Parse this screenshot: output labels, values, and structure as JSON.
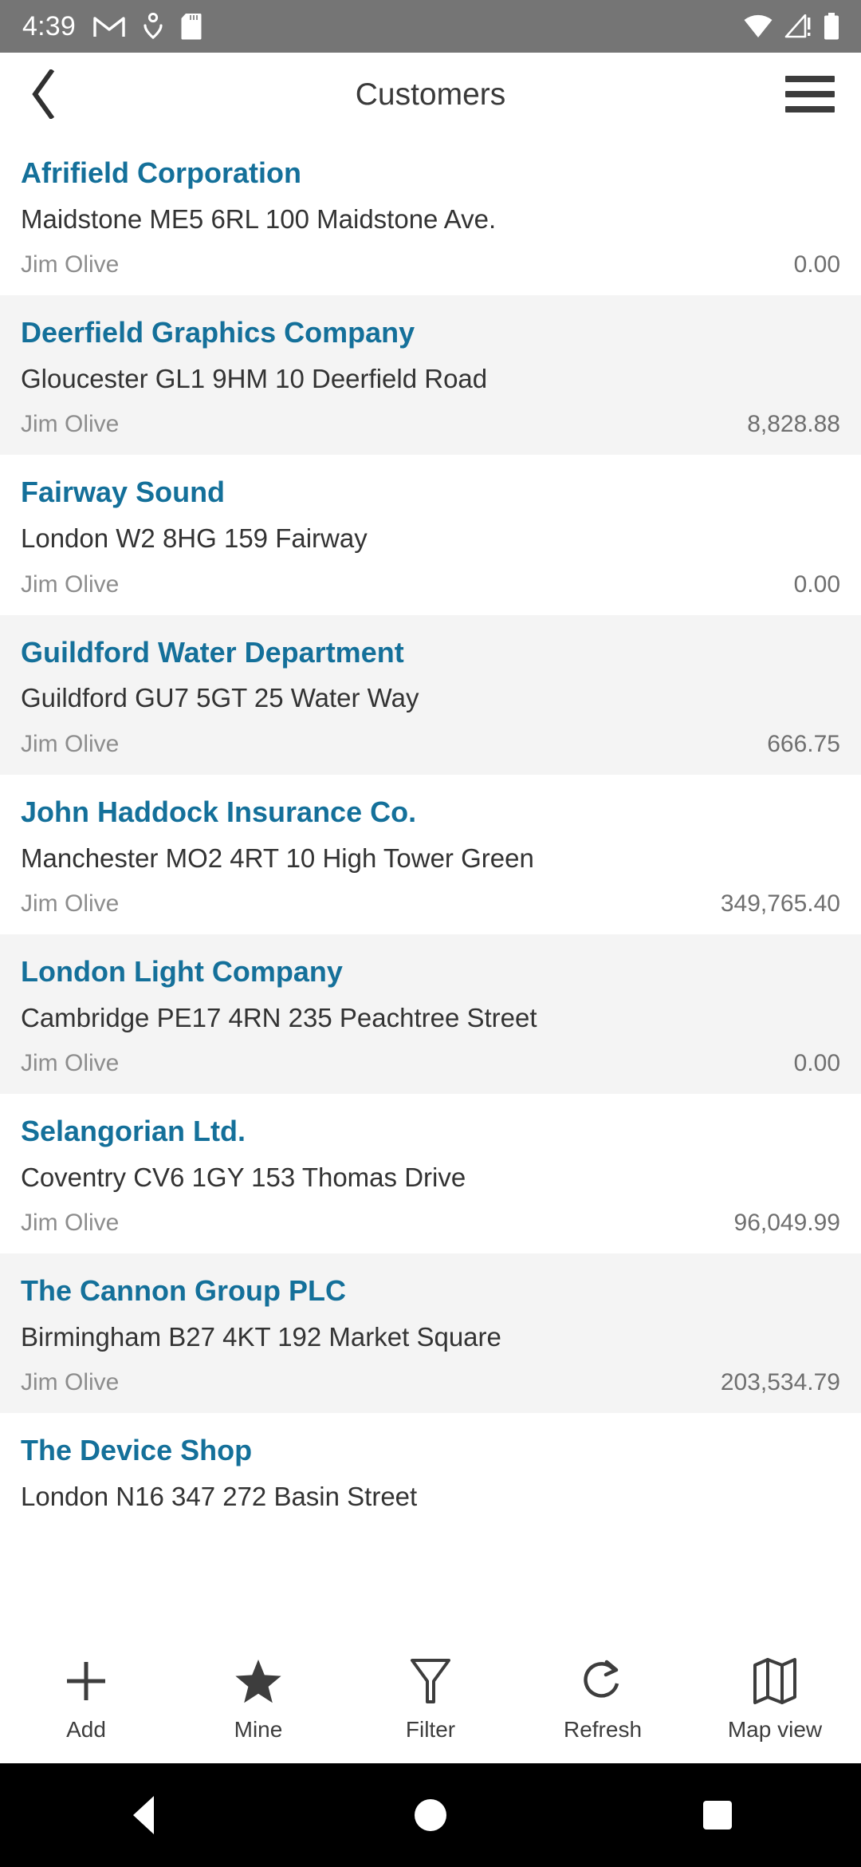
{
  "status_bar": {
    "time": "4:39",
    "left_icons": [
      "gmail-icon",
      "fitness-person-icon",
      "sd-card-icon"
    ],
    "right_icons": [
      "wifi-icon",
      "no-signal-alert-icon",
      "battery-icon"
    ],
    "background_color": "#757575"
  },
  "appbar": {
    "back_icon": "chevron-left-icon",
    "title": "Customers",
    "menu_icon": "hamburger-menu-icon"
  },
  "theme": {
    "accent": "#14709a",
    "row_alt_background": "#f4f4f4",
    "address_color": "#333333",
    "meta_color": "#8d8d8d"
  },
  "list": {
    "rows": [
      {
        "company": "Afrifield Corporation",
        "address": "Maidstone ME5 6RL 100 Maidstone Ave.",
        "contact": "Jim Olive",
        "amount": "0.00"
      },
      {
        "company": "Deerfield Graphics Company",
        "address": "Gloucester GL1 9HM 10 Deerfield Road",
        "contact": "Jim Olive",
        "amount": "8,828.88"
      },
      {
        "company": "Fairway Sound",
        "address": "London W2 8HG 159 Fairway",
        "contact": "Jim Olive",
        "amount": "0.00"
      },
      {
        "company": "Guildford Water Department",
        "address": "Guildford GU7 5GT 25 Water Way",
        "contact": "Jim Olive",
        "amount": "666.75"
      },
      {
        "company": "John Haddock Insurance Co.",
        "address": "Manchester MO2 4RT 10 High Tower Green",
        "contact": "Jim Olive",
        "amount": "349,765.40"
      },
      {
        "company": "London Light Company",
        "address": "Cambridge PE17 4RN 235 Peachtree Street",
        "contact": "Jim Olive",
        "amount": "0.00"
      },
      {
        "company": "Selangorian Ltd.",
        "address": "Coventry CV6 1GY 153 Thomas Drive",
        "contact": "Jim Olive",
        "amount": "96,049.99"
      },
      {
        "company": "The Cannon Group PLC",
        "address": "Birmingham B27 4KT 192 Market Square",
        "contact": "Jim Olive",
        "amount": "203,534.79"
      },
      {
        "company": "The Device Shop",
        "address": "London N16 347 272 Basin Street",
        "contact": "",
        "amount": ""
      }
    ]
  },
  "toolbar": {
    "items": [
      {
        "label": "Add",
        "icon": "plus-icon"
      },
      {
        "label": "Mine",
        "icon": "star-filled-icon"
      },
      {
        "label": "Filter",
        "icon": "funnel-icon"
      },
      {
        "label": "Refresh",
        "icon": "refresh-icon"
      },
      {
        "label": "Map view",
        "icon": "map-icon"
      }
    ]
  },
  "navbar": {
    "back": "nav-back-icon",
    "home": "nav-home-icon",
    "recents": "nav-recents-icon"
  }
}
